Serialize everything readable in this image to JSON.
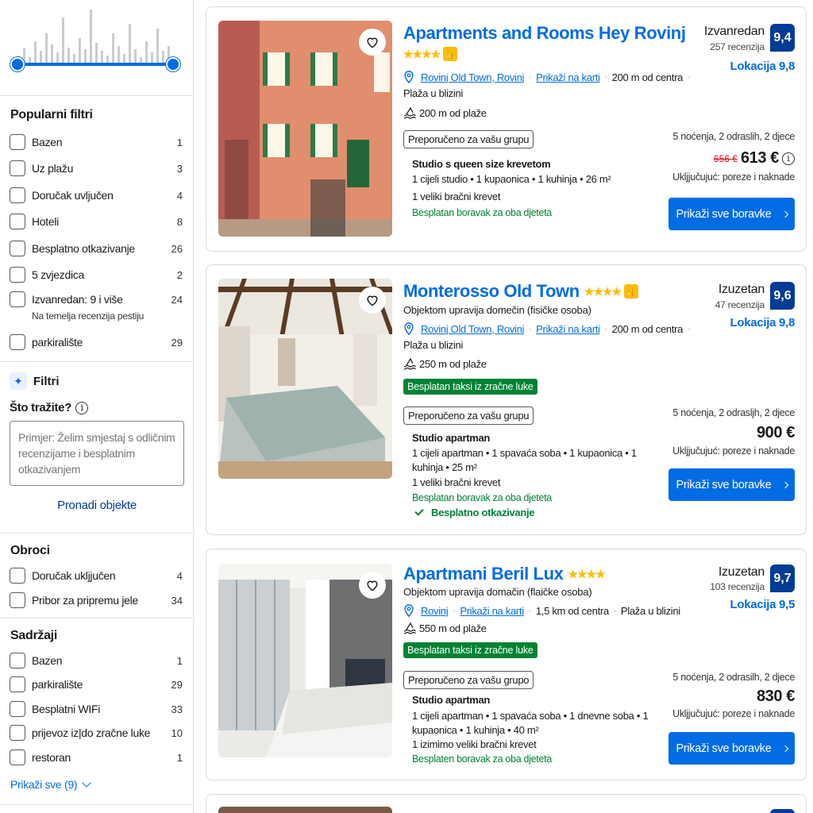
{
  "sidebar": {
    "popular": {
      "title": "Popularni filtri",
      "items": [
        {
          "label": "Bazen",
          "count": "1"
        },
        {
          "label": "Uz plažu",
          "count": "3"
        },
        {
          "label": "Doručak uvljučen",
          "count": "4"
        },
        {
          "label": "Hoteli",
          "count": "8"
        },
        {
          "label": "Besplatno otkazivanje",
          "count": "26"
        },
        {
          "label": "5 zvjezdica",
          "count": "2"
        },
        {
          "label": "Izvanredan: 9 i više",
          "count": "24",
          "sub": "Na temelja recenzija pestiju"
        },
        {
          "label": "parkiralište",
          "count": "29"
        }
      ]
    },
    "filtri": {
      "title": "Filtri",
      "question": "Što tražite?",
      "placeholder": "Primjer: Želim smjestaj s odličnim recenzijame i besplatnim otkazivanjem",
      "find_button": "Pronadi objekte"
    },
    "meals": {
      "title": "Obroci",
      "items": [
        {
          "label": "Doručak ukljjučen",
          "count": "4"
        },
        {
          "label": "Pribor za pripremu jele",
          "count": "34"
        }
      ]
    },
    "facilities": {
      "title": "Sadržaji",
      "items": [
        {
          "label": "Bazen",
          "count": "1"
        },
        {
          "label": "parkiralište",
          "count": "29"
        },
        {
          "label": "Besplatni WIFi",
          "count": "33"
        },
        {
          "label": "prijevoz iz|do zračne luke",
          "count": "10"
        },
        {
          "label": "restoran",
          "count": "1"
        }
      ],
      "show_all": "Prikaži sve (9)"
    }
  },
  "listings": [
    {
      "name": "Apartments and Rooms Hey Rovinj",
      "stars": "★★★★",
      "location": "Rovinj Old Town, Rovinj",
      "map_link": "Prikaži na karti",
      "distance": "200 m od centra",
      "beach_nearby": "Plaža u blizini",
      "beach_distance": "200 m od plaže",
      "recommended": "Preporučeno za vašu grupu",
      "room_title": "Studio s queen size krevetom",
      "room_desc": "1 cijeli studio • 1 kupaonica • 1 kuhinja • 26 m²",
      "bed": "1 veliki bračni krevet",
      "kids": "Besplatan boravak za oba djeteta",
      "rating_word": "Izvanredan",
      "reviews": "257 recenzija",
      "score": "9,4",
      "location_score": "Lokacija 9,8",
      "stay": "5 noćenja, 2 odraslih, 2 djece",
      "old_price": "656 €",
      "price": "613 €",
      "taxes": "Ukljjučujuć: poreze i naknade",
      "cta": "Prikaži sve boravke"
    },
    {
      "name": "Monterosso Old Town",
      "stars": "★★★★",
      "managed": "Objektom upravija domečin (fisičke osoba)",
      "location": "Rovinj Old Town, Rovinj",
      "map_link": "Prikaži na karti",
      "distance": "200 m od centra",
      "beach_nearby": "Plaža u blizini",
      "beach_distance": "250 m od plaže",
      "taxi": "Besplatan taksi iz zračne luke",
      "recommended": "Preporučeno za vašu grupu",
      "room_title": "Studio apartman",
      "room_desc": "1 cijeli apartman • 1 spavaća soba • 1 kupaonica • 1 kuhinja • 25 m²",
      "bed": "1 veliki bračni krevet",
      "kids": "Besplatan boravak za oba djeteta",
      "free_cancel": "Besplatno otkazivanje",
      "rating_word": "Izuzetan",
      "reviews": "47 recenzija",
      "score": "9,6",
      "location_score": "Lokacija 9,8",
      "stay": "5 noćenja, 2 odrasljh, 2 djece",
      "price": "900 €",
      "taxes": "Ukljjučujuć: poreze i naknade",
      "cta": "Prikaži sve boravke"
    },
    {
      "name": "Apartmani Beril Lux",
      "stars": "★★★★",
      "managed": "Objektom upravija domačin (flaičke osoba)",
      "location": "Rovinj",
      "map_link": "Prikaži na karti",
      "distance": "1,5 km od centra",
      "beach_nearby": "Plaža u blizini",
      "beach_distance": "550 m od plaže",
      "taxi": "Besplatan taksi iz zračne luke",
      "recommended": "Preporučeno za vašu grupo",
      "room_title": "Studio apartman",
      "room_desc": "1 cijeli apartman • 1 spavaća soba • 1 dnevne soba • 1 kupaonica • 1 kuhinja • 40 m²",
      "bed": "1 izimimo veliki bračni krevet",
      "kids": "Besplaten boravak za oba djeteta",
      "rating_word": "Izuzetan",
      "reviews": "103 recenzija",
      "score": "9,7",
      "location_score": "Lokacija 9,5",
      "stay": "5 noćenja, 2 odrasilh, 2 djece",
      "price": "830 €",
      "taxes": "Ukljjučujuć: poreze i naknade",
      "cta": "Prikaži sve boravke"
    }
  ],
  "colors": {
    "brand_blue": "#006ce4",
    "dark_blue": "#003b95",
    "green": "#008234",
    "star_yellow": "#febb02",
    "price_red": "#d4111e"
  }
}
